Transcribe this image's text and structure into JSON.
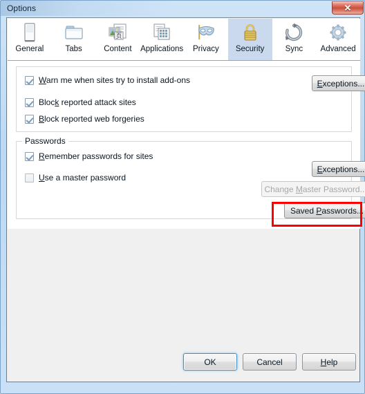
{
  "window": {
    "title": "Options",
    "close_label": "✕",
    "close_icon": "close-icon"
  },
  "tabs": [
    {
      "label": "General",
      "icon": "general-icon",
      "selected": false
    },
    {
      "label": "Tabs",
      "icon": "tabs-icon",
      "selected": false
    },
    {
      "label": "Content",
      "icon": "content-icon",
      "selected": false
    },
    {
      "label": "Applications",
      "icon": "applications-icon",
      "selected": false
    },
    {
      "label": "Privacy",
      "icon": "privacy-mask-icon",
      "selected": false
    },
    {
      "label": "Security",
      "icon": "security-lock-icon",
      "selected": true
    },
    {
      "label": "Sync",
      "icon": "sync-icon",
      "selected": false
    },
    {
      "label": "Advanced",
      "icon": "advanced-gear-icon",
      "selected": false
    }
  ],
  "security": {
    "warnings_group": {
      "checkboxes": [
        {
          "label_pre": "",
          "accel": "W",
          "label_post": "arn me when sites try to install add-ons",
          "checked": true
        },
        {
          "label_pre": "Bloc",
          "accel": "k",
          "label_post": " reported attack sites",
          "checked": true
        },
        {
          "label_pre": "",
          "accel": "B",
          "label_post": "lock reported web forgeries",
          "checked": true
        }
      ],
      "exceptions_button": {
        "pre": "",
        "accel": "E",
        "post": "xceptions..."
      }
    },
    "passwords_group": {
      "title": "Passwords",
      "checkboxes": [
        {
          "label_pre": "",
          "accel": "R",
          "label_post": "emember passwords for sites",
          "checked": true
        },
        {
          "label_pre": "",
          "accel": "U",
          "label_post": "se a master password",
          "checked": false
        }
      ],
      "exceptions_button": {
        "pre": "",
        "accel": "E",
        "post": "xceptions..."
      },
      "change_master_button": {
        "pre": "Change ",
        "accel": "M",
        "post": "aster Password...",
        "disabled": true
      },
      "saved_passwords_button": {
        "pre": "Saved ",
        "accel": "P",
        "post": "asswords...",
        "highlighted": true
      }
    }
  },
  "footer": {
    "ok": "OK",
    "cancel": "Cancel",
    "help": {
      "pre": "",
      "accel": "H",
      "post": "elp"
    }
  },
  "colors": {
    "highlight_red": "#ff0000",
    "selected_tab_bg": "#cad9ee",
    "dialog_bg": "#f0f0f0",
    "panel_bg": "#ffffff",
    "frame_blue": "#bcd9f2"
  }
}
